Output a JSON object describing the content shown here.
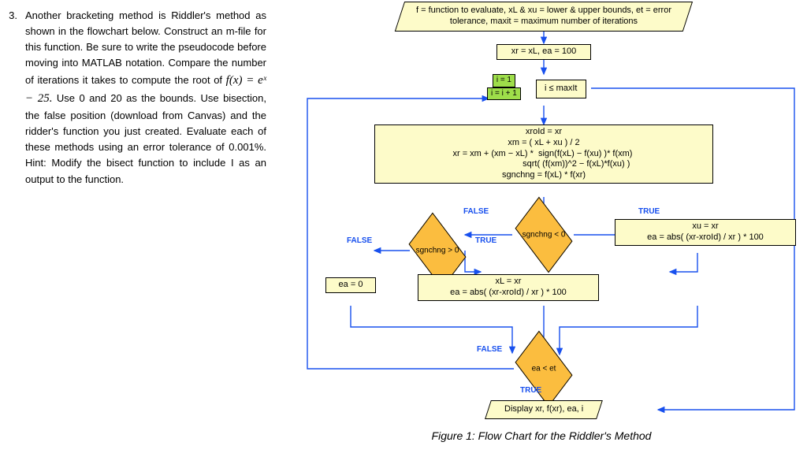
{
  "problem": {
    "number": "3.",
    "text_1": "Another bracketing method is Riddler's method as shown in the flowchart below. Construct an m-file for this function. Be sure to write the pseudocode before moving into MATLAB notation. Compare the number of iterations it takes to compute the root of",
    "equation": "f(x) = eˣ − 25.",
    "text_2": "Use 0 and 20 as the bounds. Use bisection, the false position (download from Canvas) and the ridder's function you just created. Evaluate each of these methods using an error tolerance of 0.001%. Hint: Modify the bisect function to include I as an output to the function."
  },
  "flow": {
    "input_top": "f = function to evaluate, xL & xu = lower & upper bounds, et = error\ntolerance, maxit = maximum number of iterations",
    "init": "xr = xL, ea = 100",
    "loop_i1": "i = 1",
    "loop_inc": "i = i + 1",
    "loop_cond": "i ≤ maxIt",
    "calc": "xroId = xr\nxm = ( xL + xu ) / 2\nxr = xm + (xm − xL) *  sign(f(xL) − f(xu) )* f(xm) \n                           sqrt( (f(xm))^2 − f(xL)*f(xu) )\nsgnchng = f(xL) * f(xr)",
    "dec_sgnlt": "sgnchng < 0",
    "dec_sgngt": "sgnchng > 0",
    "box_ea0": "ea = 0",
    "box_xl": "xL = xr\nea = abs( (xr-xroId) / xr ) * 100",
    "box_xu": "xu = xr\nea = abs( (xr-xroId) / xr ) * 100",
    "dec_ea": "ea < et",
    "out": "Display xr, f(xr), ea, i",
    "true": "TRUE",
    "false": "FALSE",
    "caption": "Figure 1: Flow Chart for the Riddler's Method"
  }
}
